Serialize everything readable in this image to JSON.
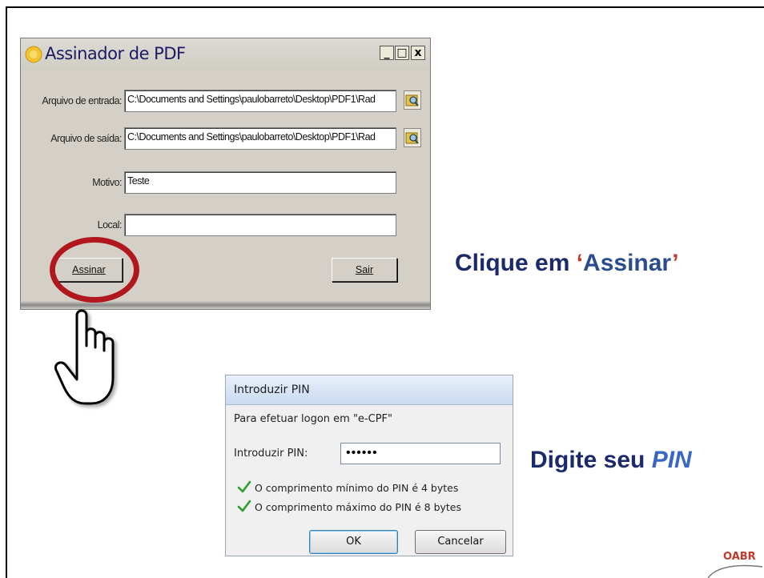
{
  "assinador": {
    "title": "Assinador de PDF",
    "controls": {
      "minimize": "_",
      "maximize": "□",
      "close": "x"
    },
    "arquivo_entrada_label": "Arquivo de entrada:",
    "arquivo_entrada_value": "C:\\Documents and Settings\\paulobarreto\\Desktop\\PDF1\\Rad",
    "arquivo_saida_label": "Arquivo de saída:",
    "arquivo_saida_value": "C:\\Documents and Settings\\paulobarreto\\Desktop\\PDF1\\Rad",
    "motivo_label": "Motivo:",
    "motivo_value": "Teste",
    "local_label": "Local:",
    "local_value": "",
    "assinar_label": "Assinar",
    "sair_label": "Sair"
  },
  "captions": {
    "clique_prefix": "Clique em ",
    "clique_quote_open": "‘",
    "clique_target": "Assinar",
    "clique_quote_close": "’",
    "digite_prefix": "Digite seu ",
    "digite_emph": "PIN"
  },
  "pin_dialog": {
    "title": "Introduzir PIN",
    "logon_text": "Para efetuar logon em \"e-CPF\"",
    "pin_label": "Introduzir PIN:",
    "pin_value": "••••••",
    "rule_min": "O comprimento mínimo do PIN é 4 bytes",
    "rule_max": "O comprimento máximo do PIN é 8 bytes",
    "ok_label": "OK",
    "cancel_label": "Cancelar"
  },
  "footer": {
    "logo_text": "OABR"
  },
  "colors": {
    "caption": "#1b2a6b",
    "highlight": "#b0181e",
    "check": "#2e9e2e"
  }
}
